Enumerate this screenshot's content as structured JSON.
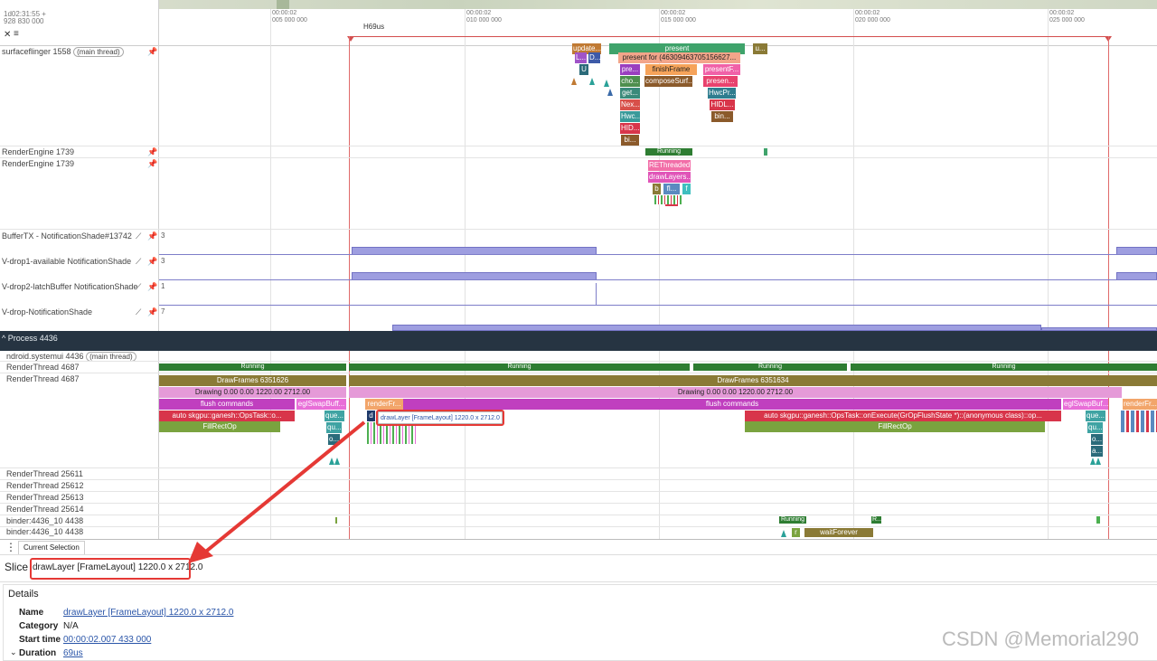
{
  "header": {
    "clock": "1d02:31:55 +",
    "clock_sub": "928 830 000",
    "ticks": [
      {
        "a": "00:00:02",
        "b": "005 000 000"
      },
      {
        "a": "00:00:02",
        "b": "010 000 000"
      },
      {
        "a": "00:00:02",
        "b": "015 000 000"
      },
      {
        "a": "00:00:02",
        "b": "020 000 000"
      },
      {
        "a": "00:00:02",
        "b": "025 000 000"
      }
    ],
    "span_label": "69us"
  },
  "tracks": {
    "surfaceflinger": {
      "label": "surfaceflinger 1558",
      "badge": "main thread"
    },
    "re1": "RenderEngine 1739",
    "re2": "RenderEngine 1739",
    "buftx": "BufferTX - NotificationShade#13742",
    "vdrop1": "V-drop1-available NotificationShade",
    "vdrop2": "V-drop2-latchBuffer NotificationShade",
    "vdrop": "V-drop-NotificationShade",
    "buftx_max": "3",
    "vdrop1_max": "3",
    "vdrop2_max": "1",
    "vdrop_max": "7"
  },
  "process": {
    "title": "Process 4436",
    "main": {
      "label": "ndroid.systemui 4436",
      "badge": "main thread"
    },
    "rt1": "RenderThread 4687",
    "rt2": "RenderThread 4687",
    "rt3": "RenderThread 25611",
    "rt4": "RenderThread 25612",
    "rt5": "RenderThread 25613",
    "rt6": "RenderThread 25614",
    "b1": "binder:4436_10 4438",
    "b2": "binder:4436_10 4438"
  },
  "slices": {
    "sf_update": "update...",
    "sf_present": "present",
    "sf_u": "u...",
    "sf_presentfor": "present for  (46309463705156627...",
    "sf_finish": "finishFrame",
    "sf_presentf": "presentF...",
    "sf_l": "L...",
    "sf_d": "D...",
    "sf_U": "U",
    "sf_cho": "cho...",
    "sf_compose": "composeSurf...",
    "sf_presen2": "presen...",
    "sf_pre": "pre...",
    "sf_get": "get...",
    "sf_hwcpr": "HwcPr...",
    "sf_nex": "Nex...",
    "sf_hidl": "HIDL...",
    "sf_hwc": "Hwc...",
    "sf_bin": "bin...",
    "sf_hid": "HID...",
    "sf_bi": "bi...",
    "re_running": "Running",
    "re_threaded": "REThreaded...",
    "re_drawlayers": "drawLayers...",
    "re_b": "b",
    "re_fl": "fl...",
    "re_f": "f",
    "re_a": "a",
    "rt_running": "Running",
    "rt_running2": "Running",
    "rt_running3": "Running",
    "rt_running4": "Running",
    "df1": "DrawFrames 6351626",
    "df2": "DrawFrames 6351634",
    "drawing1": "Drawing  0.00  0.00 1220.00 2712.00",
    "drawing2": "Drawing  0.00  0.00 1220.00 2712.00",
    "flush1": "flush commands",
    "flush2": "flush commands",
    "egl1": "eglSwapBuff...",
    "egl2": "eglSwapBuf...",
    "render1": "renderFr...",
    "render2": "renderFr...",
    "sk1": "auto skgpu::ganesh::OpsTask::o...",
    "sk2": "auto skgpu::ganesh::OpsTask::onExecute(GrOpFlushState *)::(anonymous class)::op...",
    "que1": "que...",
    "que2": "que...",
    "qu": "qu...",
    "qu2": "qu...",
    "o1": "o...",
    "o2": "o...",
    "a1": "a...",
    "fill1": "FillRectOp",
    "fill2": "FillRectOp",
    "d": "d",
    "drawlayer_tip": "drawLayer [FrameLayout] 1220.0 x 2712.0 - [200us]",
    "b_running": "Running",
    "b_r": "R...",
    "b_r2": "r",
    "b_wait": "waitForever"
  },
  "bottom": {
    "tab": "Current Selection",
    "slice_label": "Slice",
    "slice_title": "drawLayer [FrameLayout] 1220.0 x 2712.0",
    "details": "Details",
    "rows": [
      {
        "k": "Name",
        "v": "drawLayer [FrameLayout] 1220.0 x 2712.0",
        "link": true
      },
      {
        "k": "Category",
        "v": "N/A",
        "link": false
      },
      {
        "k": "Start time",
        "v": "00:00:02.007 433 000",
        "link": true
      },
      {
        "k": "Duration",
        "v": "69us",
        "link": true
      }
    ]
  },
  "watermark": "CSDN @Memorial290"
}
